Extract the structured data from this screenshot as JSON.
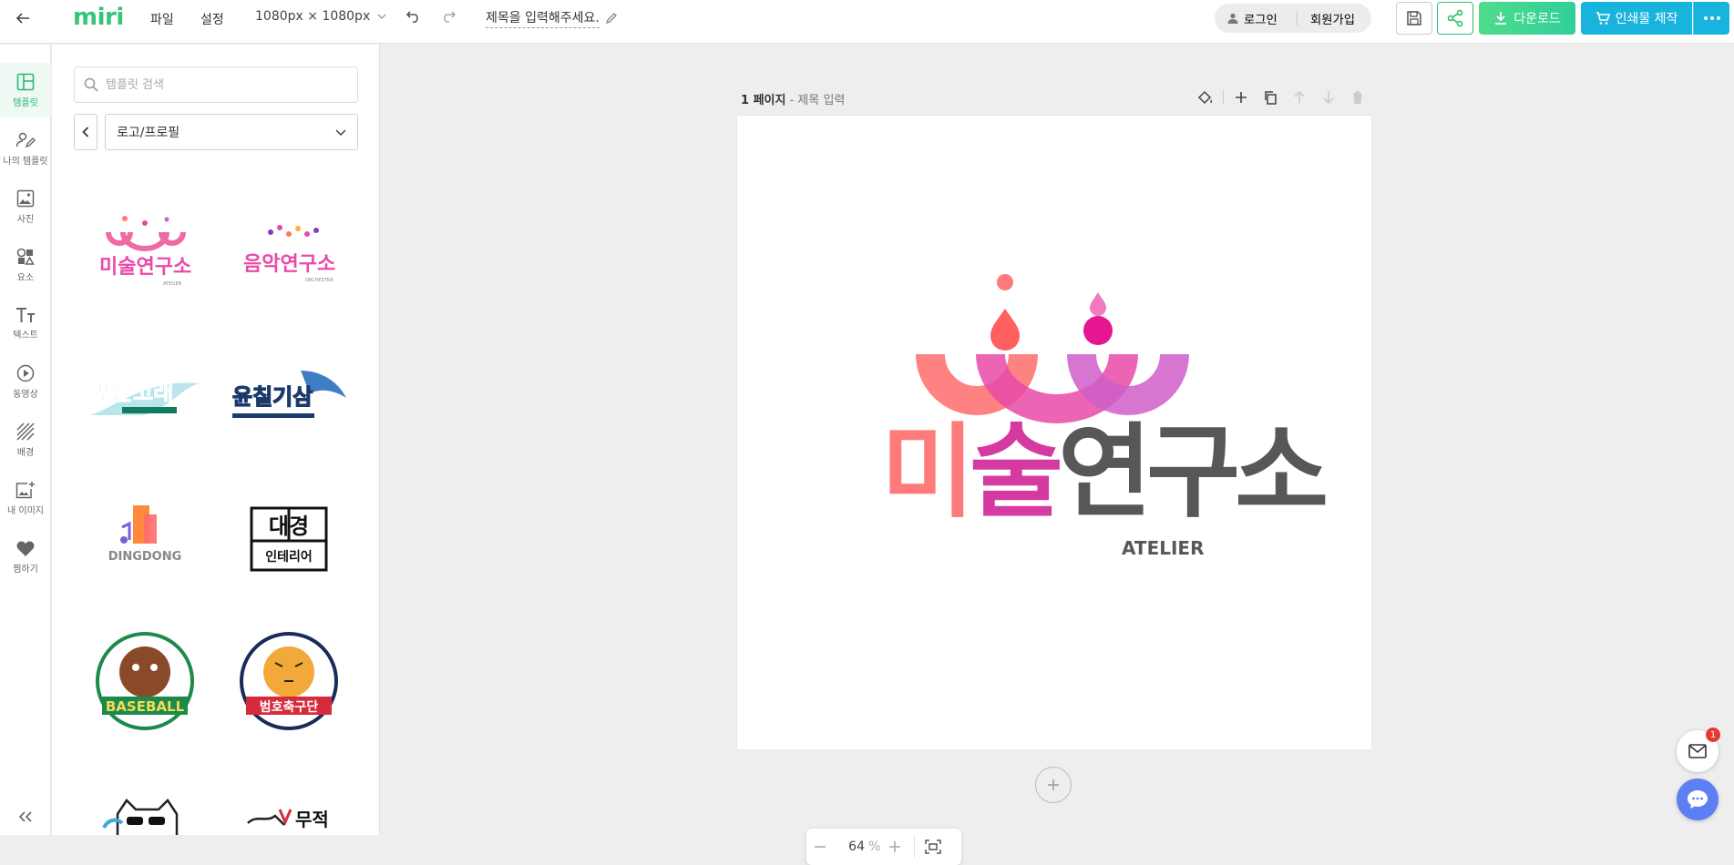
{
  "brand": {
    "logo_text": "miri"
  },
  "topbar": {
    "menu_file": "파일",
    "menu_settings": "설정",
    "canvas_size": "1080px × 1080px",
    "title_placeholder": "제목을 입력해주세요.",
    "login": "로그인",
    "signup": "회원가입",
    "download": "다운로드",
    "print": "인쇄물 제작"
  },
  "rail": {
    "items": [
      {
        "label": "템플릿",
        "icon": "layout-icon",
        "active": true
      },
      {
        "label": "나의 템플릿",
        "icon": "user-edit-icon"
      },
      {
        "label": "사진",
        "icon": "image-icon"
      },
      {
        "label": "요소",
        "icon": "shapes-icon"
      },
      {
        "label": "텍스트",
        "icon": "text-icon"
      },
      {
        "label": "동영상",
        "icon": "play-icon"
      },
      {
        "label": "배경",
        "icon": "hatch-icon"
      },
      {
        "label": "내 이미지",
        "icon": "add-image-icon"
      },
      {
        "label": "찜하기",
        "icon": "heart-icon"
      }
    ]
  },
  "panel": {
    "search_placeholder": "템플릿 검색",
    "category": "로고/프로필",
    "templates": [
      {
        "name": "art-lab-logo",
        "text": "미술연구소",
        "sub": "ATELIER"
      },
      {
        "name": "music-lab-logo",
        "text": "음악연구소",
        "sub": "ORCHESTRA"
      },
      {
        "name": "blue-whale-logo",
        "text": "푸른고래",
        "sub": ""
      },
      {
        "name": "fishing-club-logo",
        "text": "윤칠기삼",
        "sub": ""
      },
      {
        "name": "dingdong-logo",
        "text": "DINGDONG",
        "sub": ""
      },
      {
        "name": "interior-logo",
        "text": "대경",
        "sub": "인테리어"
      },
      {
        "name": "baseball-logo",
        "text": "BASEBALL",
        "sub": ""
      },
      {
        "name": "tiger-football-logo",
        "text": "범호축구단",
        "sub": ""
      },
      {
        "name": "cat-logo",
        "text": "",
        "sub": ""
      },
      {
        "name": "invincible-logo",
        "text": "무적",
        "sub": ""
      }
    ]
  },
  "workspace": {
    "page_number": "1 페이지",
    "page_title": "- 제목 입력",
    "zoom_value": "64",
    "zoom_unit": "%",
    "mail_badge": "1"
  },
  "canvas_logo": {
    "main_text": "미술연구소",
    "sub_text": "ATELIER",
    "colors": {
      "coral": "#ff7b7b",
      "pink": "#e94aa8",
      "magenta": "#d43aa0",
      "violet": "#cf5ec8",
      "gray": "#575757"
    }
  },
  "colors": {
    "accent_green": "#2bbf6f",
    "accent_blue": "#19b4dd"
  }
}
